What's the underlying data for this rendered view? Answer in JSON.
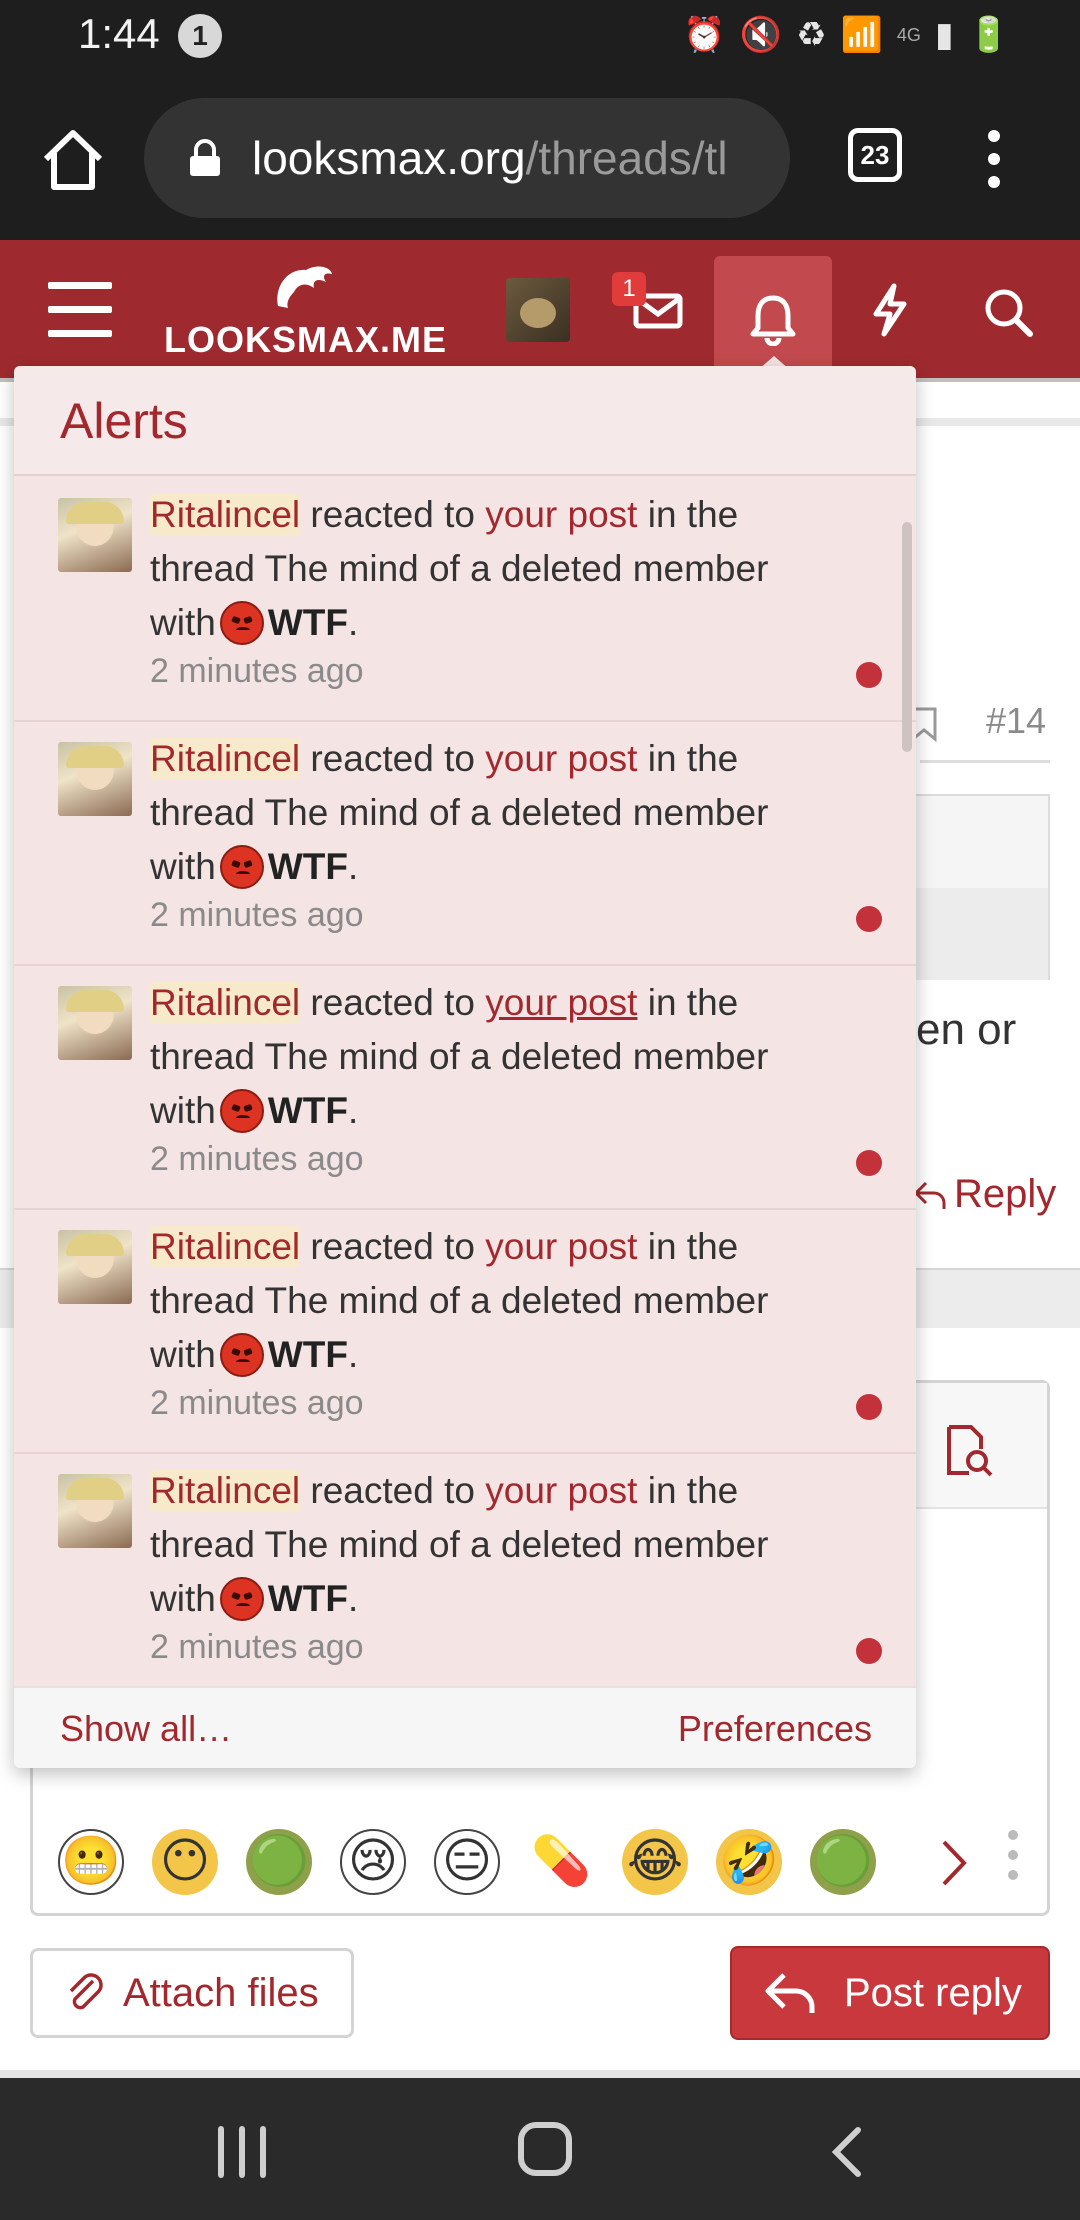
{
  "status_bar": {
    "time": "1:44",
    "notification_count": "1",
    "network": "4G",
    "icons": [
      "alarm-icon",
      "mute-icon",
      "battery-saver-icon",
      "wifi-icon",
      "signal-icon",
      "battery-icon"
    ]
  },
  "browser": {
    "url_host": "looksmax.org",
    "url_path": "/threads/tl",
    "tab_count": "23"
  },
  "site_header": {
    "logo_text": "LOOKSMAX.ME",
    "inbox_badge": "1"
  },
  "page": {
    "post_number": "#14",
    "body_fragment": "en or",
    "reply_label": "Reply",
    "attach_label": "Attach files",
    "post_reply_label": "Post reply",
    "emoji_row": [
      "😬",
      "😶",
      "🟢",
      "😢",
      "😑",
      "💊",
      "😂",
      "🤣",
      "🟢"
    ]
  },
  "alerts": {
    "title": "Alerts",
    "show_all": "Show all…",
    "preferences": "Preferences",
    "items": [
      {
        "user": "Ritalincel",
        "action": "reacted to",
        "link": "your post",
        "middle": "in the thread The mind of a deleted member with",
        "reaction": "WTF",
        "time": "2 minutes ago"
      },
      {
        "user": "Ritalincel",
        "action": "reacted to",
        "link": "your post",
        "middle": "in the thread The mind of a deleted member with",
        "reaction": "WTF",
        "time": "2 minutes ago"
      },
      {
        "user": "Ritalincel",
        "action": "reacted to",
        "link": "your post",
        "middle": "in the thread The mind of a deleted member with",
        "reaction": "WTF",
        "time": "2 minutes ago"
      },
      {
        "user": "Ritalincel",
        "action": "reacted to",
        "link": "your post",
        "middle": "in the thread The mind of a deleted member with",
        "reaction": "WTF",
        "time": "2 minutes ago"
      },
      {
        "user": "Ritalincel",
        "action": "reacted to",
        "link": "your post",
        "middle": "in the thread The mind of a deleted member with",
        "reaction": "WTF",
        "time": "2 minutes ago"
      }
    ]
  },
  "colors": {
    "brand": "#9e2a2f",
    "accent_link": "#a3282d",
    "popup_bg": "#f4e4e4",
    "unread_dot": "#c3323a"
  }
}
